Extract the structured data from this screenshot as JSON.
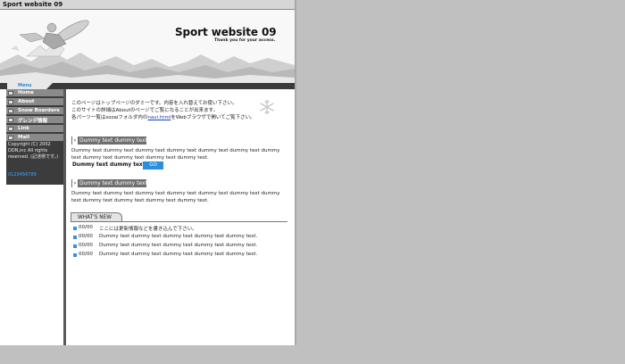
{
  "window": {
    "title": "Sport website 09"
  },
  "header": {
    "site_title": "Sport website 09",
    "tagline": "Thank you for your access."
  },
  "menubar": {
    "label": "Menu"
  },
  "sidebar": {
    "items": [
      {
        "label": "Home"
      },
      {
        "label": "About"
      },
      {
        "label": "Snow Boarders"
      },
      {
        "label": "ゲレンデ情報"
      },
      {
        "label": "Link"
      },
      {
        "label": "Mail"
      }
    ],
    "copyright": "Copyright (C) 2002 DDN,inc All rights reserved. (記述例です。)",
    "phone": "0123456789"
  },
  "intro": {
    "line1": "このページはトップページのダミーです。内容を入れ替えてお使い下さい。",
    "line2": "このサイトの詳細はAboutのページでご覧になることが出来ます。",
    "line3_pre": "各パーツ一覧はsozaiフォルダ内の",
    "line3_link": "navi.html",
    "line3_post": "をWebブラウザで開いてご覧下さい。"
  },
  "sections": [
    {
      "heading": "Dummy text dummy text",
      "body": "Dummy text dummy text dummy text dummy text dummy text dummy text dummy text dummy text dummy text dummy text dummy text.",
      "go_label": "Dummy text dummy text",
      "go_button": "GO"
    },
    {
      "heading": "Dummy text dummy text",
      "body": "Dummy text dummy text dummy text dummy text dummy text dummy text dummy text dummy text dummy text dummy text dummy text."
    }
  ],
  "news": {
    "tab_label": "WHAT'S NEW",
    "items": [
      {
        "date": "00/00",
        "text": "ここには更新情報などを書き込んで下さい。"
      },
      {
        "date": "00/00",
        "text": "Dummy text dummy text dummy text dummy text dummy text."
      },
      {
        "date": "00/00",
        "text": "Dummy text dummy text dummy text dummy text dummy text."
      },
      {
        "date": "00/00",
        "text": "Dummy text dummy text dummy text dummy text dummy text."
      }
    ]
  },
  "colors": {
    "accent": "#2a8fe0",
    "nav": "#8a8a8a",
    "sidebar": "#3c3c3c",
    "background": "#c0c0c0"
  },
  "icons": {
    "nav_bullet": "square-bullet-icon",
    "snow": "snowflake-icon",
    "section": "chevron-right-icon",
    "news_bullet": "square-bullet-icon"
  }
}
